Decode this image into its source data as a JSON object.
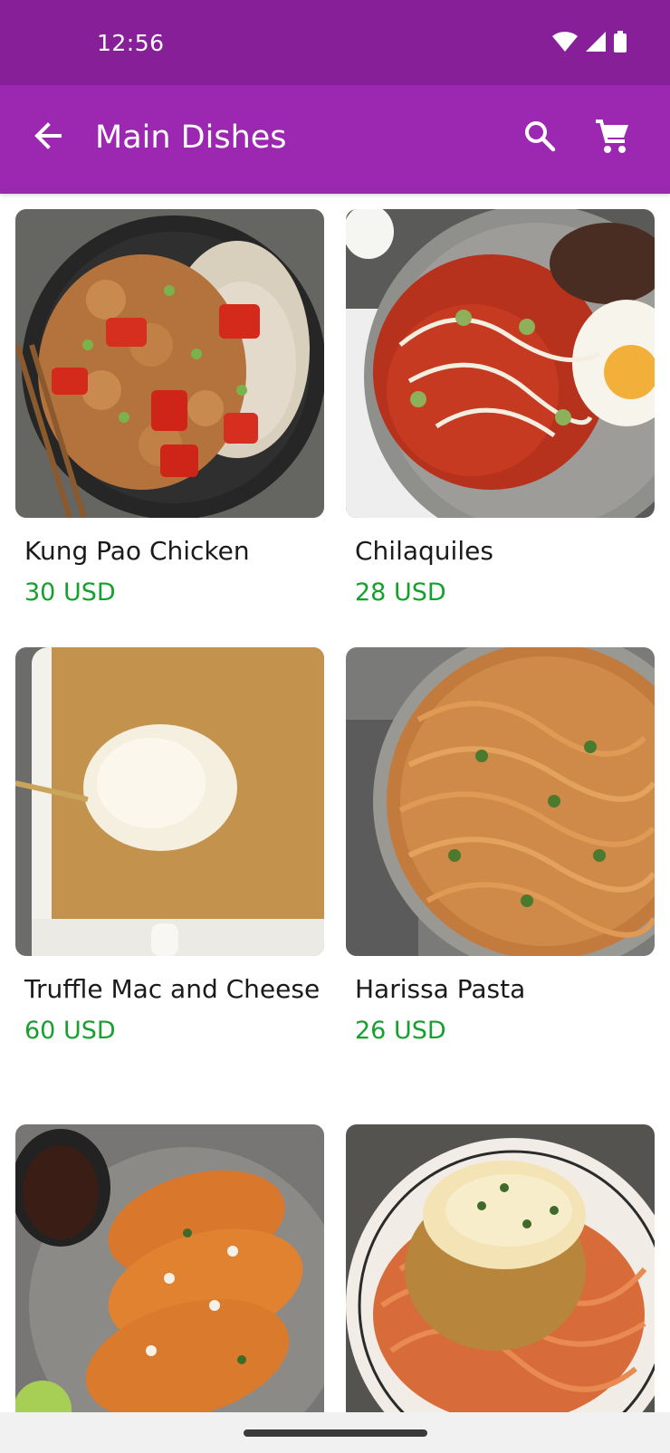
{
  "status_bar": {
    "time": "12:56",
    "icons": [
      "wifi-icon",
      "cellular-signal-icon",
      "battery-icon"
    ]
  },
  "app_bar": {
    "title": "Main Dishes",
    "back_icon": "arrow-back-icon",
    "search_icon": "search-icon",
    "cart_icon": "shopping-cart-icon"
  },
  "colors": {
    "status_bar": "#861f98",
    "app_bar": "#9c27b0",
    "price": "#16a02e"
  },
  "dishes": [
    {
      "name": "Kung Pao Chicken",
      "price": "30 USD"
    },
    {
      "name": "Chilaquiles",
      "price": "28 USD"
    },
    {
      "name": "Truffle Mac and Cheese",
      "price": "60 USD"
    },
    {
      "name": "Harissa Pasta",
      "price": "26 USD"
    },
    {
      "name": "",
      "price": ""
    },
    {
      "name": "",
      "price": ""
    }
  ]
}
